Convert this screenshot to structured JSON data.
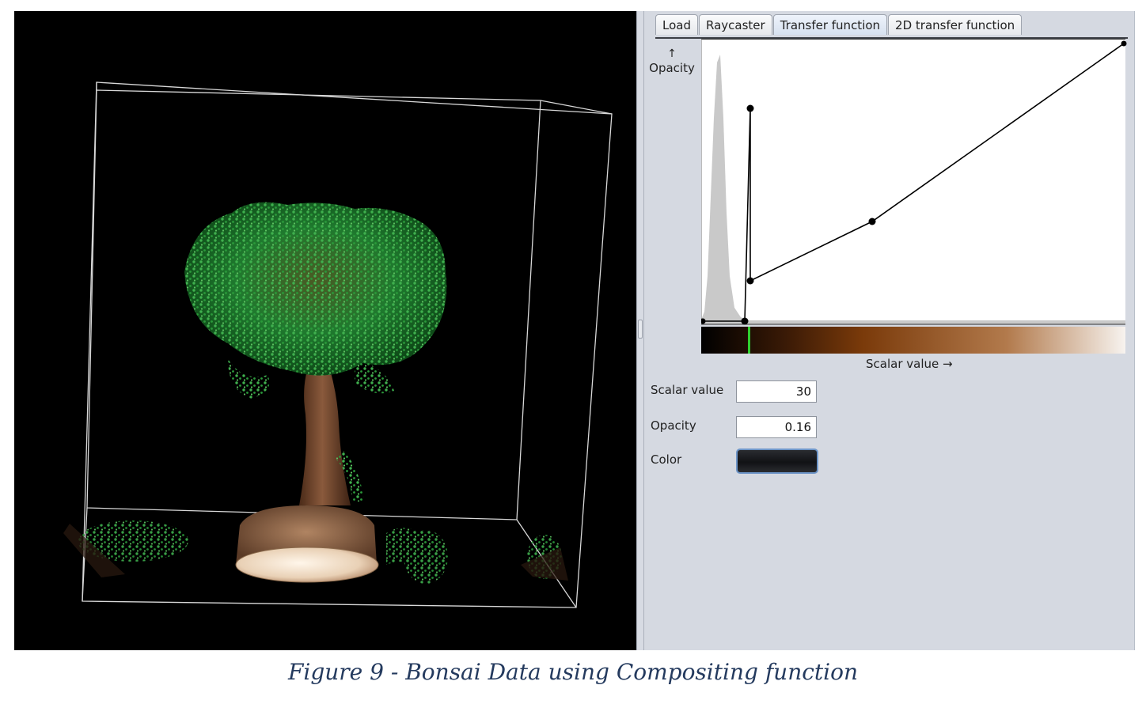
{
  "tabs": [
    {
      "label": "Load",
      "active": false
    },
    {
      "label": "Raycaster",
      "active": false
    },
    {
      "label": "Transfer function",
      "active": true
    },
    {
      "label": "2D transfer function",
      "active": false
    }
  ],
  "editor": {
    "y_axis_label": "Opacity",
    "y_axis_arrow": "↑",
    "x_axis_label": "Scalar value →",
    "histogram_color": "#c9c9c9",
    "curve_color": "#000000",
    "selected_marker_color": "#2fcf2f",
    "gradient_colors": [
      "#000000",
      "#3a1a06",
      "#7a3a0a",
      "#b27a4c",
      "#f7f3ef"
    ]
  },
  "fields": {
    "scalar_value": {
      "label": "Scalar value",
      "value": "30"
    },
    "opacity": {
      "label": "Opacity",
      "value": "0.16"
    },
    "color": {
      "label": "Color",
      "value": "#15161a"
    }
  },
  "caption": "Figure 9 - Bonsai Data using Compositing function"
}
